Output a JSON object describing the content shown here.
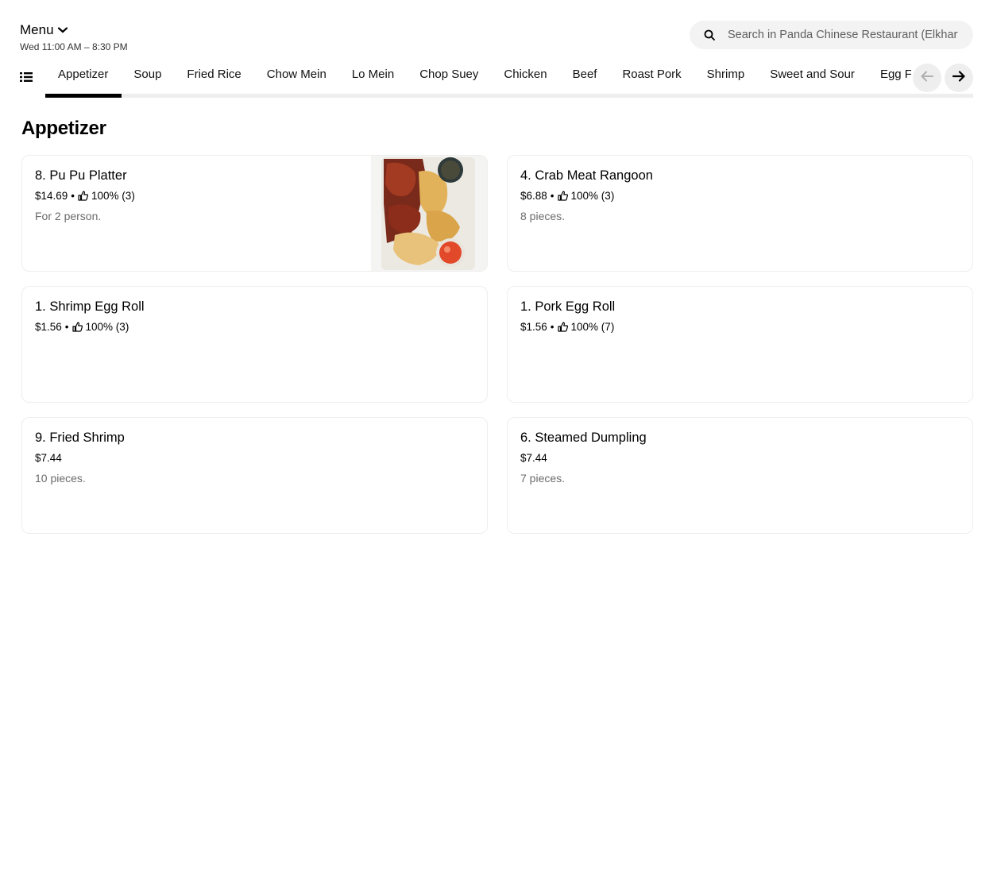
{
  "header": {
    "menu_label": "Menu",
    "hours": "Wed 11:00 AM – 8:30 PM"
  },
  "search": {
    "placeholder": "Search in Panda Chinese Restaurant (Elkhart"
  },
  "tabs": [
    {
      "label": "Appetizer"
    },
    {
      "label": "Soup"
    },
    {
      "label": "Fried Rice"
    },
    {
      "label": "Chow Mein"
    },
    {
      "label": "Lo Mein"
    },
    {
      "label": "Chop Suey"
    },
    {
      "label": "Chicken"
    },
    {
      "label": "Beef"
    },
    {
      "label": "Roast Pork"
    },
    {
      "label": "Shrimp"
    },
    {
      "label": "Sweet and Sour"
    },
    {
      "label": "Egg Fo"
    }
  ],
  "section": {
    "title": "Appetizer"
  },
  "items": [
    {
      "name": "8. Pu Pu Platter",
      "price": "$14.69",
      "rating": "100% (3)",
      "description": "For 2 person."
    },
    {
      "name": "4. Crab Meat Rangoon",
      "price": "$6.88",
      "rating": "100% (3)",
      "description": "8 pieces."
    },
    {
      "name": "1. Shrimp Egg Roll",
      "price": "$1.56",
      "rating": "100% (3)",
      "description": ""
    },
    {
      "name": "1. Pork Egg Roll",
      "price": "$1.56",
      "rating": "100% (7)",
      "description": ""
    },
    {
      "name": "9. Fried Shrimp",
      "price": "$7.44",
      "rating": "",
      "description": "10 pieces."
    },
    {
      "name": "6. Steamed Dumpling",
      "price": "$7.44",
      "rating": "",
      "description": "7 pieces."
    }
  ],
  "colors": {
    "accent": "#000000",
    "muted_text": "#6b6b6b",
    "search_bg": "#f3f3f3"
  },
  "icons": {
    "menu_chevron": "chevron-down-icon",
    "search": "search-icon",
    "list": "list-icon",
    "prev": "arrow-left-icon",
    "next": "arrow-right-icon",
    "rating": "thumbs-up-icon"
  }
}
